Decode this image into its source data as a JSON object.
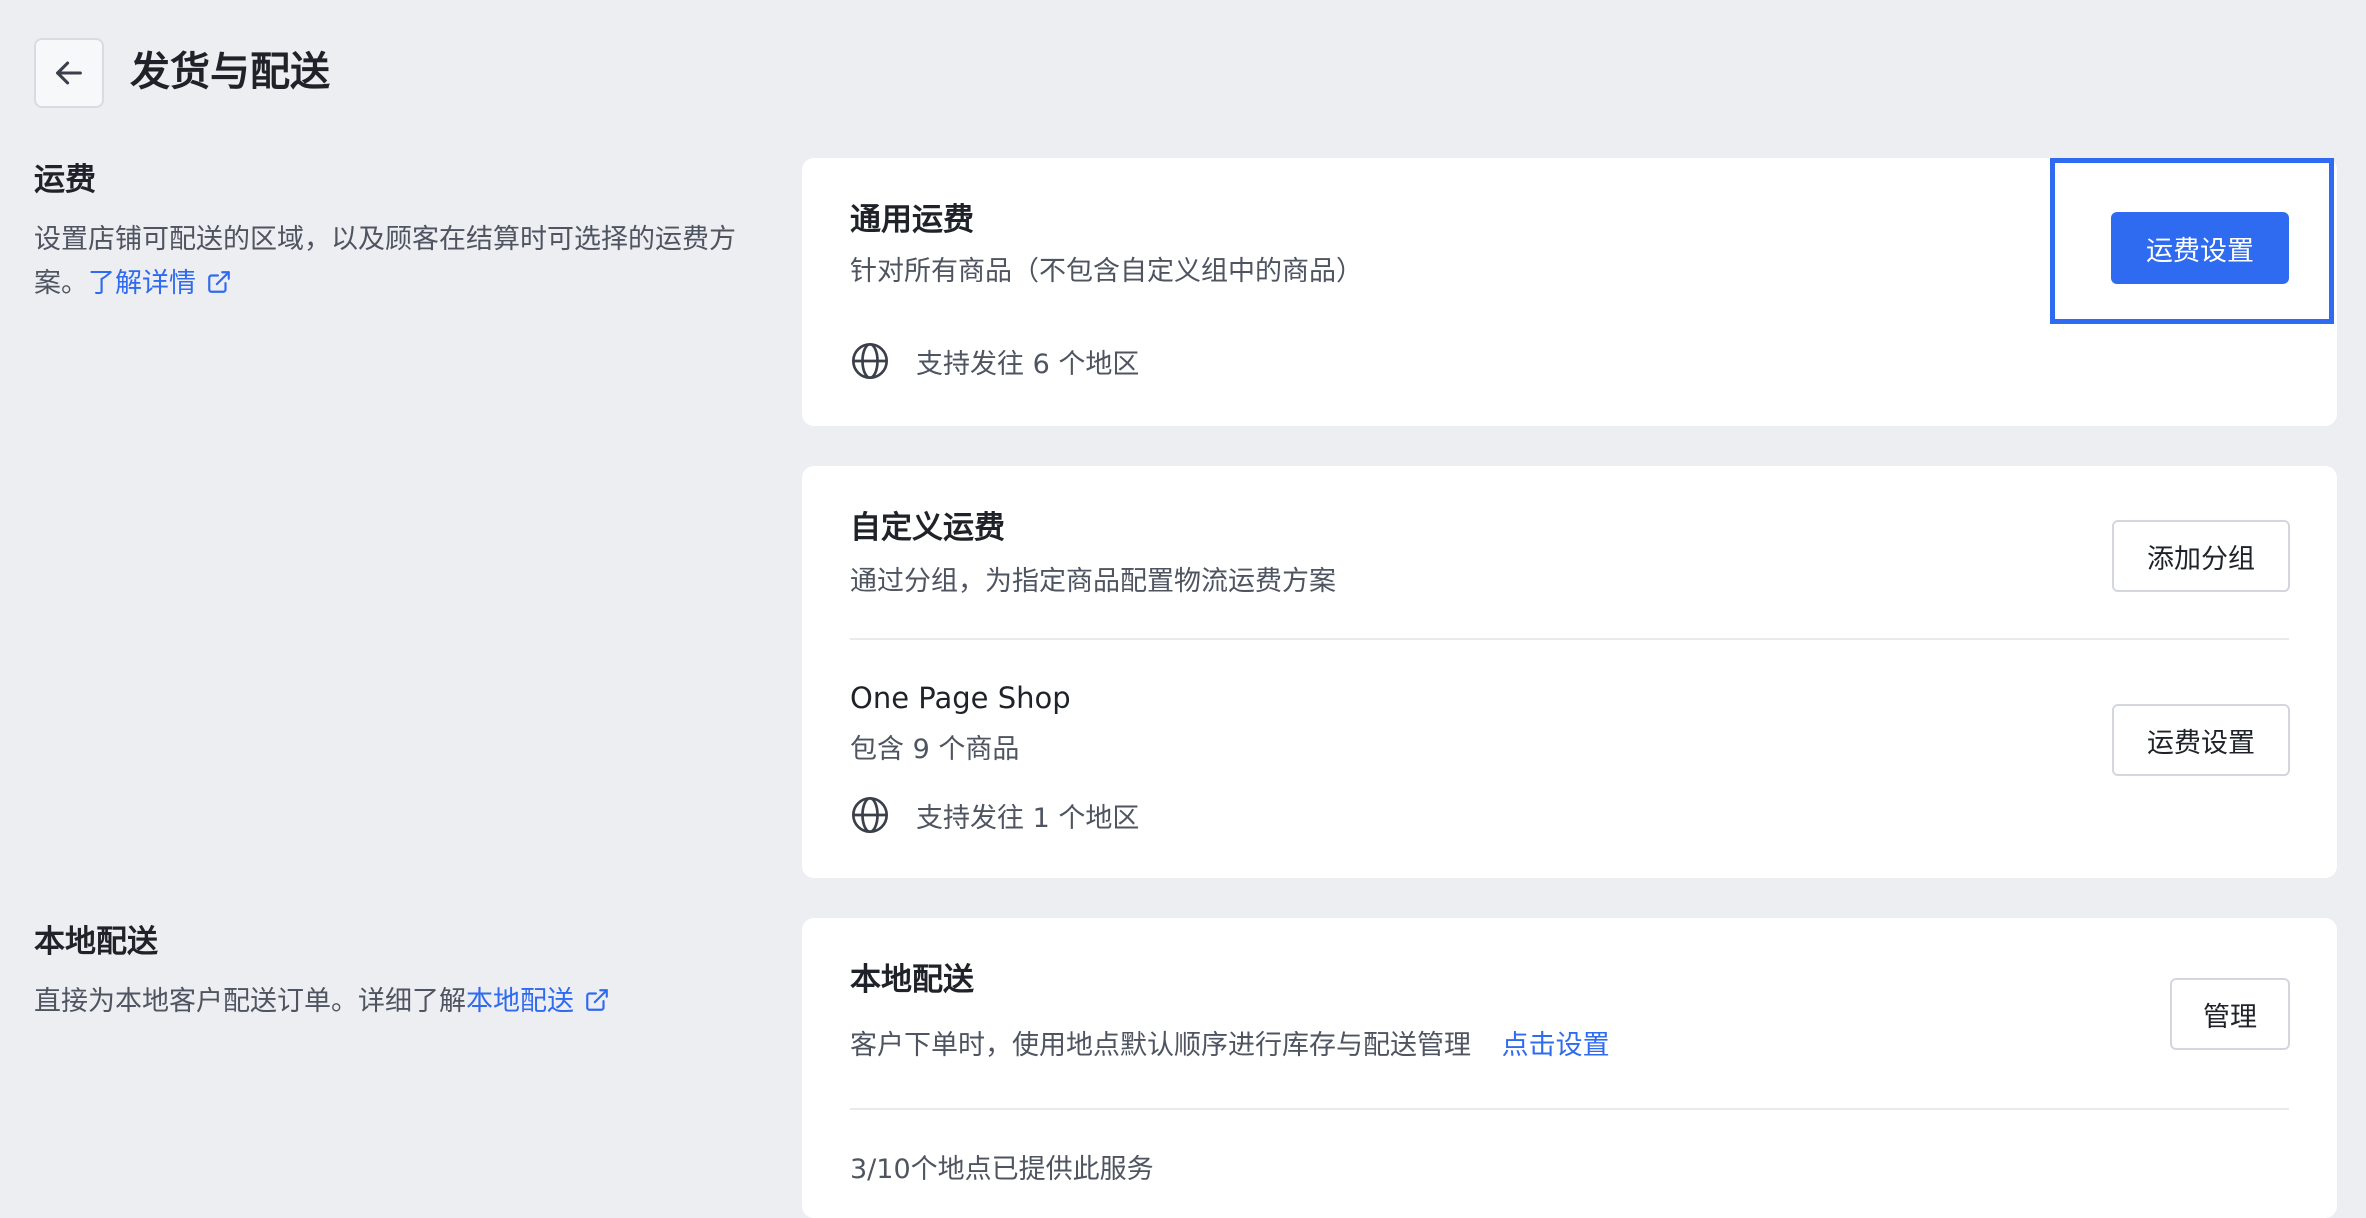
{
  "header": {
    "title": "发货与配送",
    "back_icon": "arrow-left-icon"
  },
  "shipping_section": {
    "title": "运费",
    "description": "设置店铺可配送的区域，以及顾客在结算时可选择的运费方案。",
    "link_text": "了解详情"
  },
  "general_shipping": {
    "title": "通用运费",
    "subtitle": "针对所有商品（不包含自定义组中的商品）",
    "regions": "支持发往 6 个地区",
    "button_label": "运费设置"
  },
  "custom_shipping": {
    "title": "自定义运费",
    "subtitle": "通过分组，为指定商品配置物流运费方案",
    "add_button_label": "添加分组",
    "groups": [
      {
        "name": "One Page Shop",
        "products": "包含 9 个商品",
        "regions": "支持发往 1 个地区",
        "button_label": "运费设置"
      }
    ]
  },
  "local_section": {
    "title": "本地配送",
    "description": "直接为本地客户配送订单。详细了解",
    "link_text": "本地配送"
  },
  "local_delivery": {
    "title": "本地配送",
    "subtitle": "客户下单时，使用地点默认顺序进行库存与配送管理",
    "link_text": "点击设置",
    "manage_button_label": "管理",
    "status": "3/10个地点已提供此服务"
  },
  "colors": {
    "primary": "#2f6bf0",
    "background": "#edeef2",
    "card": "#ffffff"
  }
}
